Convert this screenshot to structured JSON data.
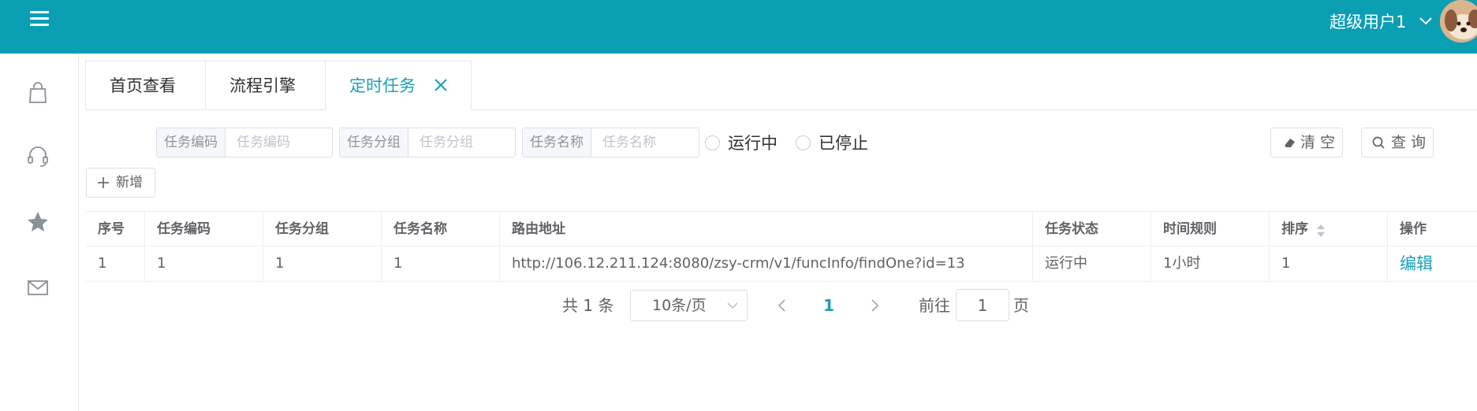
{
  "header": {
    "user_name": "超级用户1",
    "colors": {
      "bar": "#0b9fb3",
      "accent": "#1a9fb6"
    }
  },
  "sidebar": {
    "items": [
      {
        "icon": "shopping-bag-icon"
      },
      {
        "icon": "headset-icon"
      },
      {
        "icon": "star-icon"
      },
      {
        "icon": "mail-icon"
      }
    ]
  },
  "tabs": [
    {
      "label": "首页查看",
      "active": false
    },
    {
      "label": "流程引擎",
      "active": false
    },
    {
      "label": "定时任务",
      "active": true
    }
  ],
  "filters": {
    "task_code": {
      "prefix": "任务编码",
      "placeholder": "任务编码",
      "value": ""
    },
    "task_group": {
      "prefix": "任务分组",
      "placeholder": "任务分组",
      "value": ""
    },
    "task_name": {
      "prefix": "任务名称",
      "placeholder": "任务名称",
      "value": ""
    },
    "status_options": [
      {
        "label": "运行中",
        "checked": false
      },
      {
        "label": "已停止",
        "checked": false
      }
    ],
    "clear_label": "清 空",
    "query_label": "查 询"
  },
  "toolbar": {
    "add_label": "新增"
  },
  "table": {
    "columns": [
      "序号",
      "任务编码",
      "任务分组",
      "任务名称",
      "路由地址",
      "任务状态",
      "时间规则",
      "排序",
      "操作"
    ],
    "rows": [
      {
        "index": "1",
        "code": "1",
        "group": "1",
        "name": "1",
        "route": "http://106.12.211.124:8080/zsy-crm/v1/funcInfo/findOne?id=13",
        "status": "运行中",
        "schedule": "1小时",
        "order": "1",
        "action": "编辑"
      }
    ]
  },
  "pagination": {
    "total_text": "共 1 条",
    "page_size": "10条/页",
    "current_page": "1",
    "goto_label": "前往",
    "goto_value": "1",
    "page_unit": "页"
  }
}
